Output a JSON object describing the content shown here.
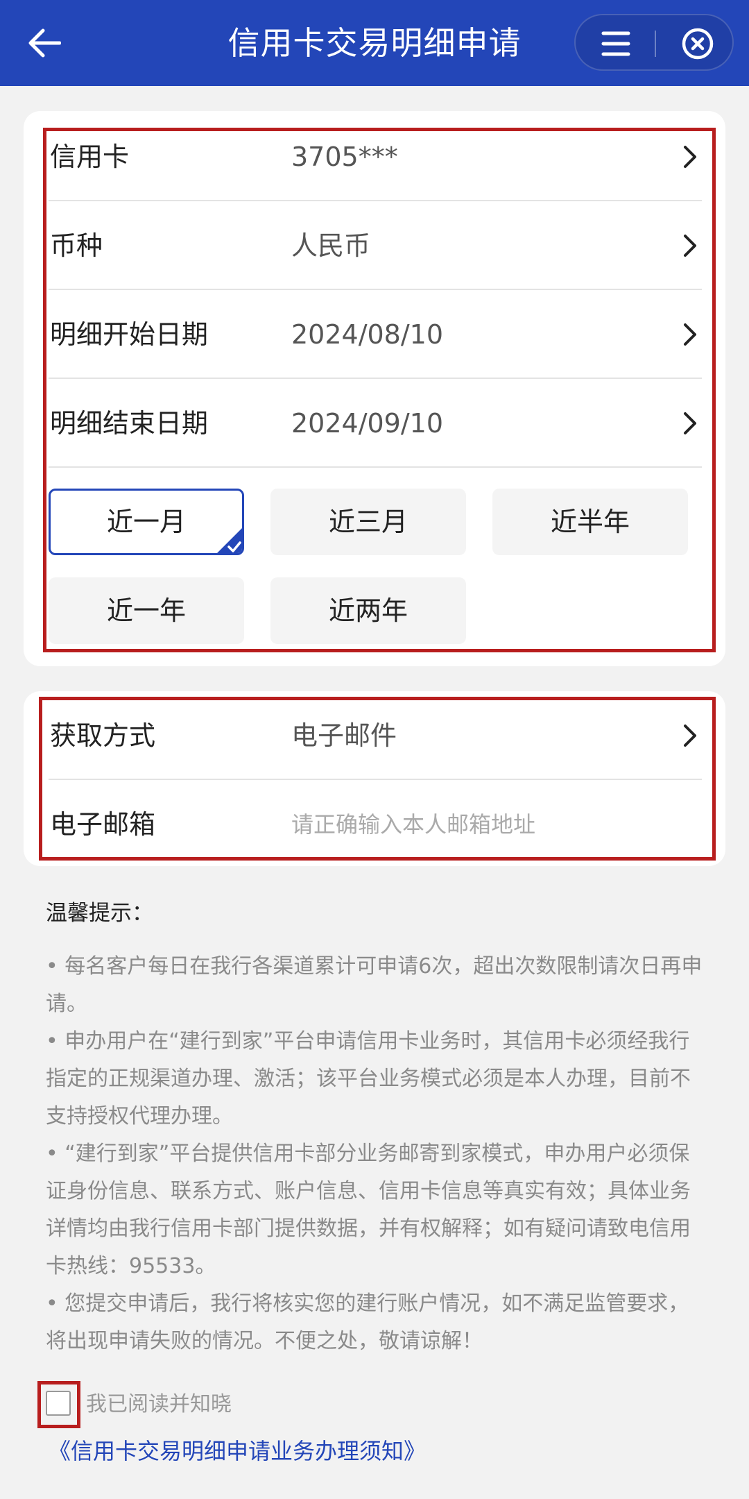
{
  "header": {
    "title": "信用卡交易明细申请",
    "back_icon": "arrow-left-icon",
    "menu_icon": "menu-icon",
    "close_icon": "close-circle-icon"
  },
  "details": {
    "rows": [
      {
        "label": "信用卡",
        "value": "3705***"
      },
      {
        "label": "币种",
        "value": "人民币"
      },
      {
        "label": "明细开始日期",
        "value": "2024/08/10"
      },
      {
        "label": "明细结束日期",
        "value": "2024/09/10"
      }
    ],
    "periods": [
      "近一月",
      "近三月",
      "近半年",
      "近一年",
      "近两年"
    ],
    "selected_period": "近一月"
  },
  "delivery": {
    "method_label": "获取方式",
    "method_value": "电子邮件",
    "email_label": "电子邮箱",
    "email_placeholder": "请正确输入本人邮箱地址"
  },
  "tips": {
    "title": "温馨提示：",
    "items": [
      "• 每名客户每日在我行各渠道累计可申请6次，超出次数限制请次日再申请。",
      "• 申办用户在“建行到家”平台申请信用卡业务时，其信用卡必须经我行指定的正规渠道办理、激活；该平台业务模式必须是本人办理，目前不支持授权代理办理。",
      "• “建行到家”平台提供信用卡部分业务邮寄到家模式，申办用户必须保证身份信息、联系方式、账户信息、信用卡信息等真实有效；具体业务详情均由我行信用卡部门提供数据，并有权解释；如有疑问请致电信用卡热线：95533。",
      "• 您提交申请后，我行将核实您的建行账户情况，如不满足监管要求，将出现申请失败的情况。不便之处，敬请谅解！"
    ]
  },
  "agreement": {
    "text": "我已阅读并知晓",
    "link": "《信用卡交易明细申请业务办理须知》"
  },
  "colors": {
    "brand_blue": "#2346b8",
    "highlight_red": "#b81e1e"
  }
}
